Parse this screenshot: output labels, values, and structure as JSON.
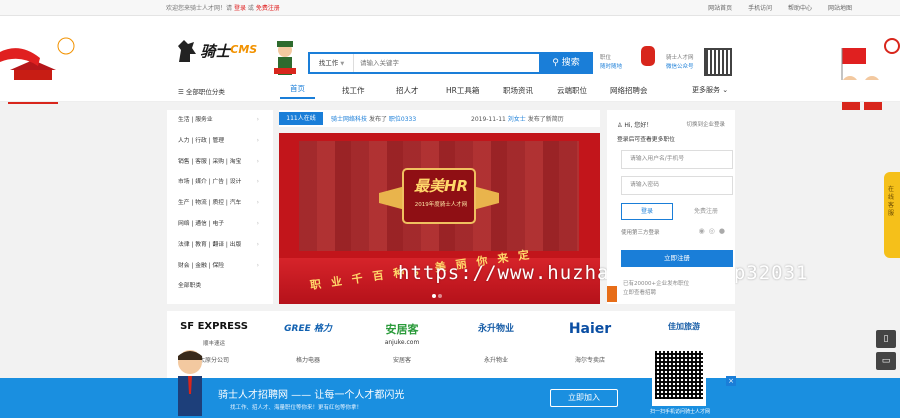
{
  "colors": {
    "accent": "#1a7ed8",
    "promo": "#1a8fe0",
    "banner": "#c2151b",
    "float": "#f5c01a"
  },
  "topbar": {
    "welcome_prefix": "欢迎您来骑士人才网！请",
    "login": "登录",
    "or": "或",
    "register": "免费注册",
    "links": [
      "网站首页",
      "手机访问",
      "帮助中心",
      "网站地图"
    ]
  },
  "header": {
    "brand": "骑士",
    "brand_suffix": "CMS",
    "search_type": "找工作",
    "search_placeholder": "请输入关键字",
    "search_button": "搜索",
    "mini_label": "职位小程序",
    "mini_line1": "职位",
    "mini_line2": "随时随地",
    "pub_label": "骑士人才网",
    "pub_line": "微信公众号"
  },
  "nav": {
    "categories": "全部职位分类",
    "items": [
      "首页",
      "找工作",
      "招人才",
      "HR工具箱",
      "职场资讯",
      "云端职位",
      "网络招聘会"
    ],
    "more": "更多服务"
  },
  "sidebar": {
    "items": [
      "生活 | 服务业",
      "人力 | 行政 | 管理",
      "销售 | 客服 | 采购 | 淘宝",
      "市场 | 媒介 | 广告 | 设计",
      "生产 | 物流 | 质控 | 汽车",
      "网络 | 通信 | 电子",
      "法律 | 教育 | 翻译 | 出版",
      "财会 | 金融 | 保险",
      "全部职类"
    ]
  },
  "ticker": {
    "tag": "111人在线",
    "msg1_name": "骑士网络科技",
    "msg1_mid": "发布了",
    "msg1_job": "职位0333",
    "msg2_date": "2019-11-11",
    "msg2_name": "刘女士",
    "msg2_action": "发布了新简历"
  },
  "banner": {
    "title": "最美HR",
    "subtitle": "2019年度骑士人才网",
    "slogan": "职业千百种，美丽你来定"
  },
  "watermark": "https://www.huzhan.com/ishop32031",
  "login": {
    "hello": "Hi, 您好！",
    "sso": "切换到企业登录",
    "tip": "登录后可查看更多职位",
    "user_placeholder": "请输入用户名/手机号",
    "pass_placeholder": "请输入密码",
    "login_btn": "登录",
    "register_btn": "免费注册",
    "other": "使用第三方登录",
    "post_btn": "立即注册",
    "note1": "已有20000+企业发布职位",
    "note2": "立即查看招聘"
  },
  "logos": [
    {
      "mark": "SF EXPRESS",
      "sub": "顺丰速运",
      "cap": "太原分公司"
    },
    {
      "mark": "GREE 格力",
      "sub": "",
      "cap": "格力电器"
    },
    {
      "mark": "安居客",
      "sub": "anjuke.com",
      "cap": "安居客"
    },
    {
      "mark": "永升物业",
      "sub": "",
      "cap": "永升物业"
    },
    {
      "mark": "Haier",
      "sub": "",
      "cap": "海尔专卖店"
    },
    {
      "mark": "佳加旅游",
      "sub": "",
      "cap": "佳加旅游"
    }
  ],
  "float_tab": "在线客服",
  "promo": {
    "head": "骑士人才招聘网 —— 让每一个人才都闪光",
    "sub": "找工作、招人才、海量职位等你来！更有红包等你拿！",
    "join": "立即加入",
    "scan": "扫一扫手机访问骑士人才网"
  }
}
